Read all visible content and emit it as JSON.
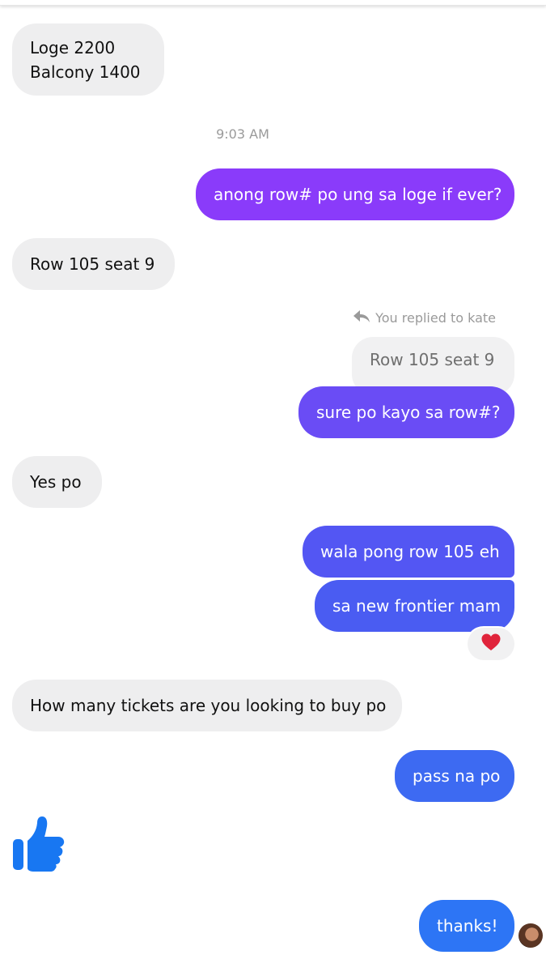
{
  "messages": {
    "m1_line1": "Loge 2200",
    "m1_line2": "Balcony 1400",
    "time": "9:03 AM",
    "m2": "anong row# po ung sa loge if ever?",
    "m3": "Row 105 seat 9",
    "reply_label": "You replied to kate",
    "quoted": "Row 105 seat 9",
    "m4": "sure po kayo sa row#?",
    "m5": "Yes po",
    "m6": "wala pong row 105 eh",
    "m7": "sa new frontier mam",
    "m8": "How many tickets are you looking to buy po",
    "m9": "pass na po",
    "m10": "thanks!"
  },
  "icons": {
    "reaction": "heart-icon",
    "sticker": "thumbs-up-icon",
    "reply": "reply-arrow-icon",
    "avatar": "avatar"
  },
  "colors": {
    "incoming": "#eeeeef",
    "outgoing_top": "#8a3bfa",
    "outgoing_bottom": "#2d75f5",
    "like": "#1877f2",
    "heart": "#e0243b"
  }
}
